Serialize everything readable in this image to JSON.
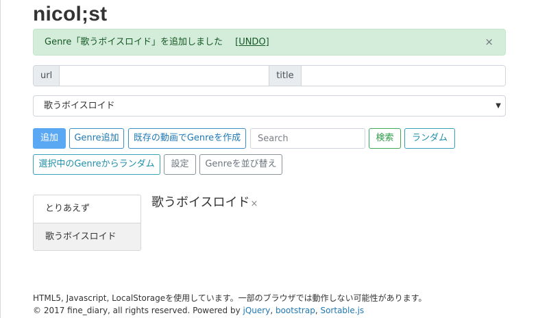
{
  "brand": "nicol;st",
  "alert": {
    "message": "Genre「歌うボイスロイド」を追加しました",
    "undo_label": "[UNDO]",
    "close_glyph": "×"
  },
  "form": {
    "url_label": "url",
    "url_value": "",
    "title_label": "title",
    "title_value": ""
  },
  "genre_select": {
    "selected": "歌うボイスロイド",
    "caret": "▼"
  },
  "toolbar": {
    "add": "追加",
    "genre_add": "Genre追加",
    "create_from_existing": "既存の動画でGenreを作成",
    "search_placeholder": "Search",
    "search": "検索",
    "random": "ランダム",
    "random_from_genre": "選択中のGenreからランダム",
    "settings": "設定",
    "sort_genres": "Genreを並び替え"
  },
  "genres": [
    {
      "label": "とりあえず",
      "active": false
    },
    {
      "label": "歌うボイスロイド",
      "active": true
    }
  ],
  "current_genre": {
    "title": "歌うボイスロイド",
    "remove_glyph": "×"
  },
  "footer": {
    "line1": "HTML5, Javascript, LocalStorageを使用しています。一部のブラウザでは動作しない可能性があります。",
    "line2_prefix": "© 2017 fine_diary, all rights reserved. Powered by ",
    "links": [
      "jQuery",
      "bootstrap",
      "Sortable.js"
    ],
    "sep1": ", ",
    "sep2": ", "
  },
  "colors": {
    "primary": "#5aa8f3",
    "alert_bg": "#d4edda",
    "alert_text": "#155724",
    "success": "#3ea857",
    "info": "#35a0b8"
  }
}
